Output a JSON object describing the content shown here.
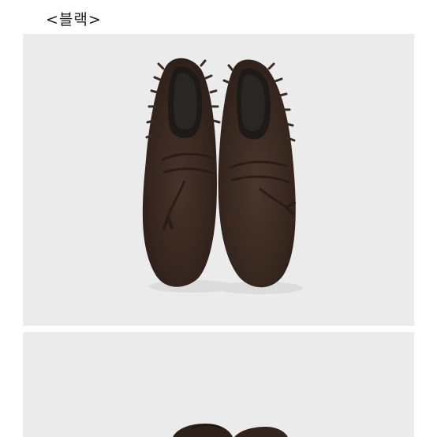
{
  "product": {
    "color_option_label": "<블랙>"
  },
  "images": [
    {
      "name": "shoes-top-view",
      "description_colors": {
        "background": "#ebebeb",
        "suede": "#3a2a22"
      }
    },
    {
      "name": "shoes-side-view"
    }
  ],
  "colors": {
    "page_background": "#ffffff",
    "photo_background": "#ebebeb",
    "suede_brown": "#3a2a22",
    "scrollbar": "#7a7a7a"
  }
}
